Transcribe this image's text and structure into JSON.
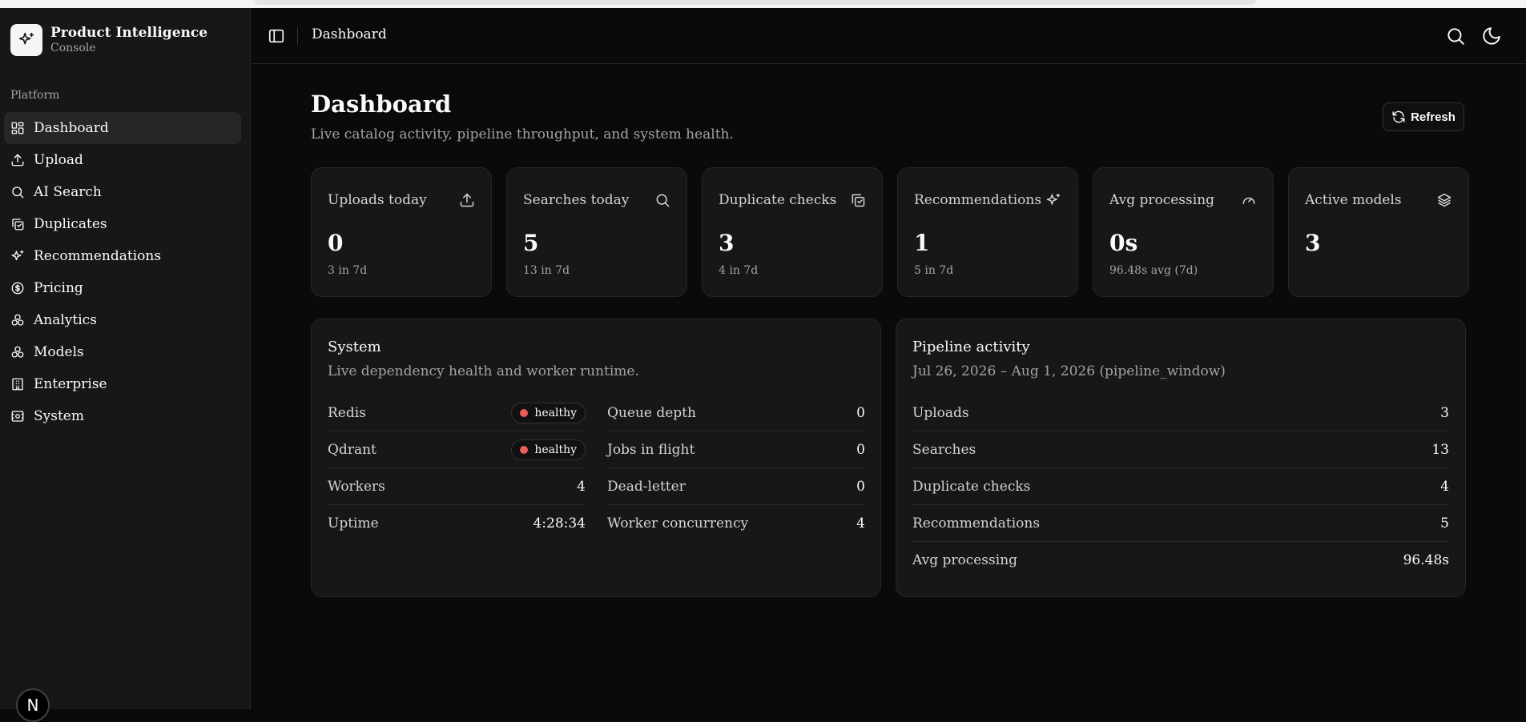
{
  "app": {
    "title": "Product Intelligence",
    "subtitle": "Console"
  },
  "sidebar": {
    "section_label": "Platform",
    "items": [
      {
        "label": "Dashboard",
        "icon": "dashboard-icon",
        "active": true
      },
      {
        "label": "Upload",
        "icon": "upload-icon"
      },
      {
        "label": "AI Search",
        "icon": "search-icon"
      },
      {
        "label": "Duplicates",
        "icon": "duplicates-icon"
      },
      {
        "label": "Recommendations",
        "icon": "sparkles-icon"
      },
      {
        "label": "Pricing",
        "icon": "dollar-icon"
      },
      {
        "label": "Analytics",
        "icon": "analytics-icon"
      },
      {
        "label": "Models",
        "icon": "models-icon"
      },
      {
        "label": "Enterprise",
        "icon": "building-icon"
      },
      {
        "label": "System",
        "icon": "system-icon"
      }
    ],
    "footer_badge": "N"
  },
  "header": {
    "title": "Dashboard"
  },
  "page": {
    "title": "Dashboard",
    "subtitle": "Live catalog activity, pipeline throughput, and system health.",
    "refresh_label": "Refresh"
  },
  "stats": [
    {
      "label": "Uploads today",
      "value": "0",
      "sub": "3 in 7d",
      "icon": "upload-icon"
    },
    {
      "label": "Searches today",
      "value": "5",
      "sub": "13 in 7d",
      "icon": "search-icon"
    },
    {
      "label": "Duplicate checks",
      "value": "3",
      "sub": "4 in 7d",
      "icon": "duplicates-icon"
    },
    {
      "label": "Recommendations",
      "value": "1",
      "sub": "5 in 7d",
      "icon": "sparkles-icon"
    },
    {
      "label": "Avg processing",
      "value": "0s",
      "sub": "96.48s avg (7d)",
      "icon": "gauge-icon"
    },
    {
      "label": "Active models",
      "value": "3",
      "sub": "",
      "icon": "layers-icon"
    }
  ],
  "system": {
    "title": "System",
    "subtitle": "Live dependency health and worker runtime.",
    "left": [
      {
        "key": "Redis",
        "value": "healthy",
        "badge": true
      },
      {
        "key": "Qdrant",
        "value": "healthy",
        "badge": true
      },
      {
        "key": "Workers",
        "value": "4"
      },
      {
        "key": "Uptime",
        "value": "4:28:34"
      }
    ],
    "right": [
      {
        "key": "Queue depth",
        "value": "0"
      },
      {
        "key": "Jobs in flight",
        "value": "0"
      },
      {
        "key": "Dead-letter",
        "value": "0"
      },
      {
        "key": "Worker concurrency",
        "value": "4"
      }
    ]
  },
  "pipeline": {
    "title": "Pipeline activity",
    "subtitle": "Jul 26, 2026 – Aug 1, 2026 (pipeline_window)",
    "rows": [
      {
        "key": "Uploads",
        "value": "3"
      },
      {
        "key": "Searches",
        "value": "13"
      },
      {
        "key": "Duplicate checks",
        "value": "4"
      },
      {
        "key": "Recommendations",
        "value": "5"
      },
      {
        "key": "Avg processing",
        "value": "96.48s"
      }
    ]
  },
  "colors": {
    "background": "#0a0a0a",
    "card": "#171717",
    "border": "#262626",
    "status_dot": "#ef5a5a"
  }
}
